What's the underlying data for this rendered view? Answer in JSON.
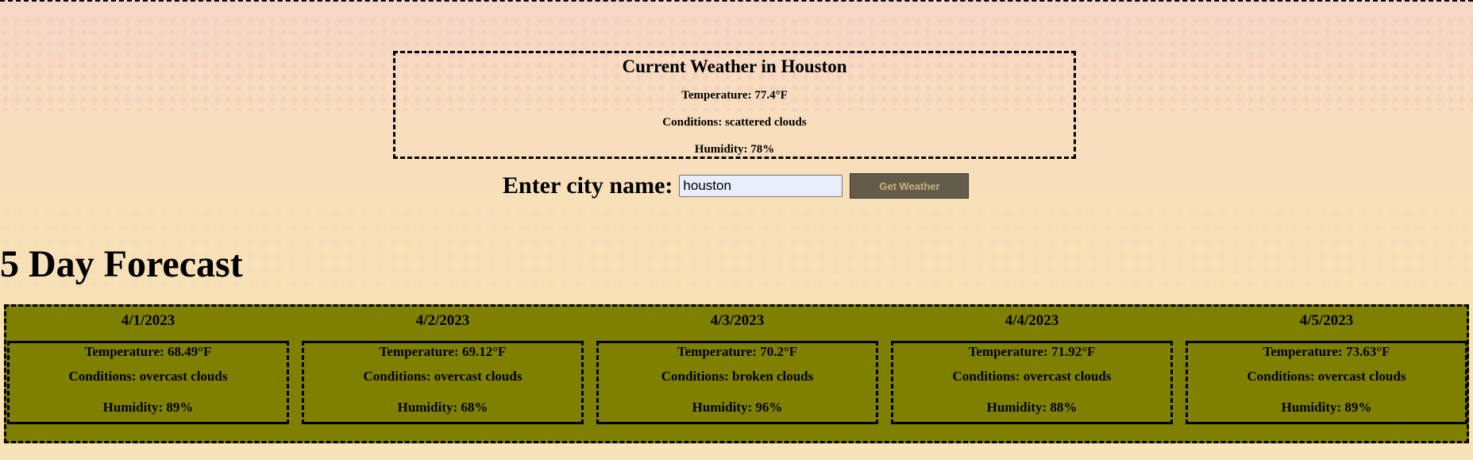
{
  "current": {
    "title": "Current Weather in Houston",
    "temperature": "Temperature: 77.4°F",
    "conditions": "Conditions: scattered clouds",
    "humidity": "Humidity: 78%"
  },
  "search": {
    "label": "Enter city name:",
    "value": "houston",
    "button_label": "Get Weather"
  },
  "forecast": {
    "title": "5 Day Forecast",
    "days": [
      {
        "date": "4/1/2023",
        "temperature": "Temperature: 68.49°F",
        "conditions": "Conditions: overcast clouds",
        "humidity": "Humidity: 89%"
      },
      {
        "date": "4/2/2023",
        "temperature": "Temperature: 69.12°F",
        "conditions": "Conditions: overcast clouds",
        "humidity": "Humidity: 68%"
      },
      {
        "date": "4/3/2023",
        "temperature": "Temperature: 70.2°F",
        "conditions": "Conditions: broken clouds",
        "humidity": "Humidity: 96%"
      },
      {
        "date": "4/4/2023",
        "temperature": "Temperature: 71.92°F",
        "conditions": "Conditions: overcast clouds",
        "humidity": "Humidity: 88%"
      },
      {
        "date": "4/5/2023",
        "temperature": "Temperature: 73.63°F",
        "conditions": "Conditions: overcast clouds",
        "humidity": "Humidity: 89%"
      }
    ]
  },
  "colors": {
    "forecast_background": "#7f7f00",
    "button_background": "#645c4a",
    "button_text": "#c8b07a",
    "input_background": "#e8eefc"
  }
}
